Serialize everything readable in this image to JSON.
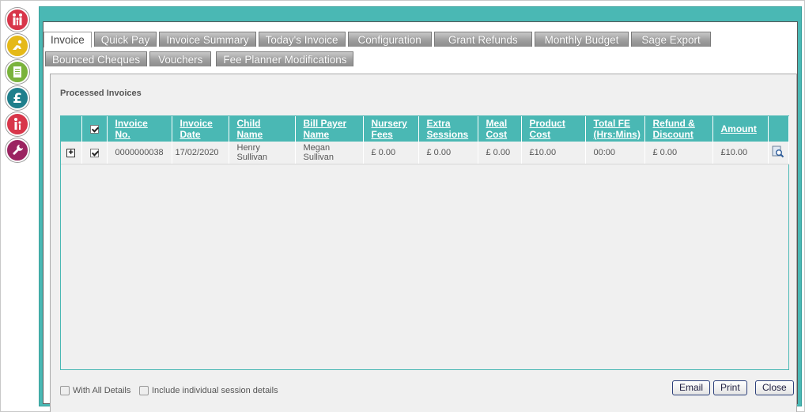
{
  "sidebar": {
    "icons": [
      "family-icon",
      "child-play-icon",
      "register-icon",
      "pound-icon",
      "parent-child-icon",
      "wrench-icon"
    ],
    "colors": [
      "#d8364a",
      "#e5b918",
      "#7ab33c",
      "#1f7f8c",
      "#d8364a",
      "#9b2461"
    ]
  },
  "tabs": {
    "row1": [
      "Invoice",
      "Quick Pay",
      "Invoice Summary",
      "Today's Invoice",
      "Configuration",
      "Grant Refunds",
      "Monthly Budget",
      "Sage Export"
    ],
    "row2": [
      "Bounced Cheques",
      "Vouchers",
      "Fee Planner Modifications"
    ],
    "active": "Invoice"
  },
  "section": {
    "title": "Processed Invoices"
  },
  "table": {
    "headers": {
      "invoice_no": "Invoice No.",
      "invoice_date": "Invoice Date",
      "child_name": "Child Name",
      "bill_payer_name": "Bill Payer Name",
      "nursery_fees": "Nursery Fees",
      "extra_sessions": "Extra Sessions",
      "meal_cost": "Meal Cost",
      "product_cost": "Product Cost",
      "total_fe": "Total FE (Hrs:Mins)",
      "refund_discount": "Refund & Discount",
      "amount": "Amount"
    },
    "rows": [
      {
        "invoice_no": "0000000038",
        "invoice_date": "17/02/2020",
        "child_name": "Henry Sullivan",
        "bill_payer_name": "Megan Sullivan",
        "nursery_fees": "£ 0.00",
        "extra_sessions": "£ 0.00",
        "meal_cost": "£ 0.00",
        "product_cost": "£10.00",
        "total_fe": "00:00",
        "refund_discount": "£ 0.00",
        "amount": "£10.00"
      }
    ]
  },
  "options": {
    "with_all_details": "With All Details",
    "include_session_details": "Include individual session details"
  },
  "buttons": {
    "email": "Email",
    "print": "Print",
    "close": "Close"
  },
  "colors": {
    "accent": "#4ab8b4",
    "tab_gray": "#9e9e9e",
    "button_border": "#2b3f7a"
  }
}
